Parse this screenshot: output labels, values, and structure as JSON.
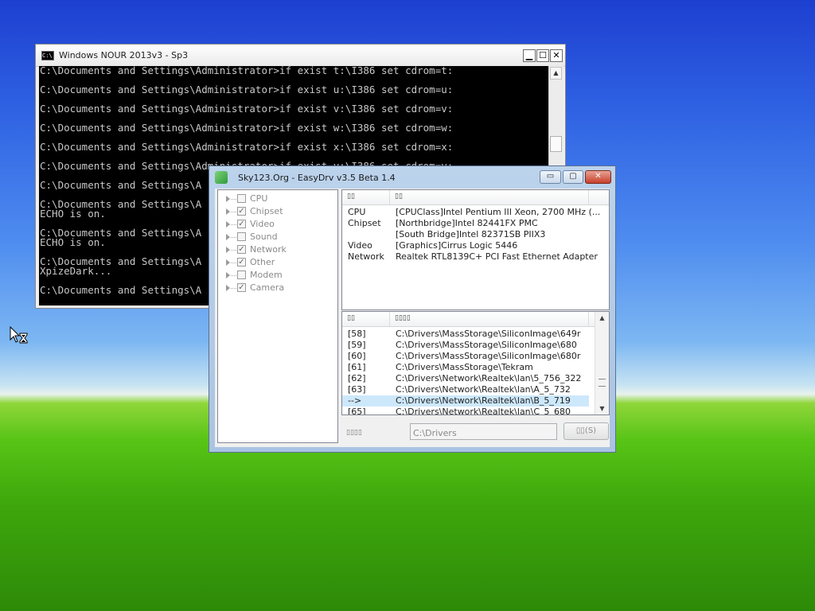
{
  "console": {
    "title": "Windows NOUR 2013v3 - Sp3",
    "icon": "cmd-icon",
    "icon_text": "C:\\",
    "lines": [
      "C:\\Documents and Settings\\Administrator>if exist t:\\I386 set cdrom=t:",
      "",
      "C:\\Documents and Settings\\Administrator>if exist u:\\I386 set cdrom=u:",
      "",
      "C:\\Documents and Settings\\Administrator>if exist v:\\I386 set cdrom=v:",
      "",
      "C:\\Documents and Settings\\Administrator>if exist w:\\I386 set cdrom=w:",
      "",
      "C:\\Documents and Settings\\Administrator>if exist x:\\I386 set cdrom=x:",
      "",
      "C:\\Documents and Settings\\Administrator>if exist y:\\I386 set cdrom=y:",
      "",
      "C:\\Documents and Settings\\A",
      "",
      "C:\\Documents and Settings\\A",
      "ECHO is on.",
      "",
      "C:\\Documents and Settings\\A",
      "ECHO is on.",
      "",
      "C:\\Documents and Settings\\A",
      "XpizeDark...",
      "",
      "C:\\Documents and Settings\\A"
    ]
  },
  "easydrv": {
    "title": "Sky123.Org - EasyDrv v3.5 Beta 1.4",
    "tree": [
      {
        "label": "CPU",
        "checked": false
      },
      {
        "label": "Chipset",
        "checked": true
      },
      {
        "label": "Video",
        "checked": true
      },
      {
        "label": "Sound",
        "checked": false
      },
      {
        "label": "Network",
        "checked": true
      },
      {
        "label": "Other",
        "checked": true
      },
      {
        "label": "Modem",
        "checked": false
      },
      {
        "label": "Camera",
        "checked": true
      }
    ],
    "hardware": {
      "headers": [
        "▯▯",
        "▯▯"
      ],
      "rows": [
        {
          "type": "CPU",
          "value": "[CPUClass]Intel Pentium III Xeon, 2700 MHz (..."
        },
        {
          "type": "Chipset",
          "value": "[Northbridge]Intel 82441FX PMC"
        },
        {
          "type": "",
          "value": "[South Bridge]Intel 82371SB PIIX3"
        },
        {
          "type": "Video",
          "value": "[Graphics]Cirrus Logic 5446"
        },
        {
          "type": "Network",
          "value": "Realtek RTL8139C+ PCI Fast Ethernet Adapter"
        }
      ]
    },
    "drivers": {
      "headers": [
        "▯▯",
        "▯▯▯▯"
      ],
      "rows": [
        {
          "idx": "[58]",
          "path": "C:\\Drivers\\MassStorage\\SiliconImage\\649r"
        },
        {
          "idx": "[59]",
          "path": "C:\\Drivers\\MassStorage\\SiliconImage\\680"
        },
        {
          "idx": "[60]",
          "path": "C:\\Drivers\\MassStorage\\SiliconImage\\680r"
        },
        {
          "idx": "[61]",
          "path": "C:\\Drivers\\MassStorage\\Tekram"
        },
        {
          "idx": "[62]",
          "path": "C:\\Drivers\\Network\\Realtek\\lan\\5_756_322"
        },
        {
          "idx": "[63]",
          "path": "C:\\Drivers\\Network\\Realtek\\lan\\A_5_732"
        },
        {
          "idx": "-->",
          "path": "C:\\Drivers\\Network\\Realtek\\lan\\B_5_719"
        },
        {
          "idx": "[65]",
          "path": "C:\\Drivers\\Network\\Realtek\\lan\\C_5_680"
        }
      ],
      "selected_index": 6
    },
    "path_label": "▯▯▯▯",
    "path_value": "C:\\Drivers",
    "scan_button": "▯▯(S)"
  },
  "colors": {
    "console_bg": "#000000",
    "console_text": "#c8c8c8",
    "selection": "#cde8fb"
  }
}
